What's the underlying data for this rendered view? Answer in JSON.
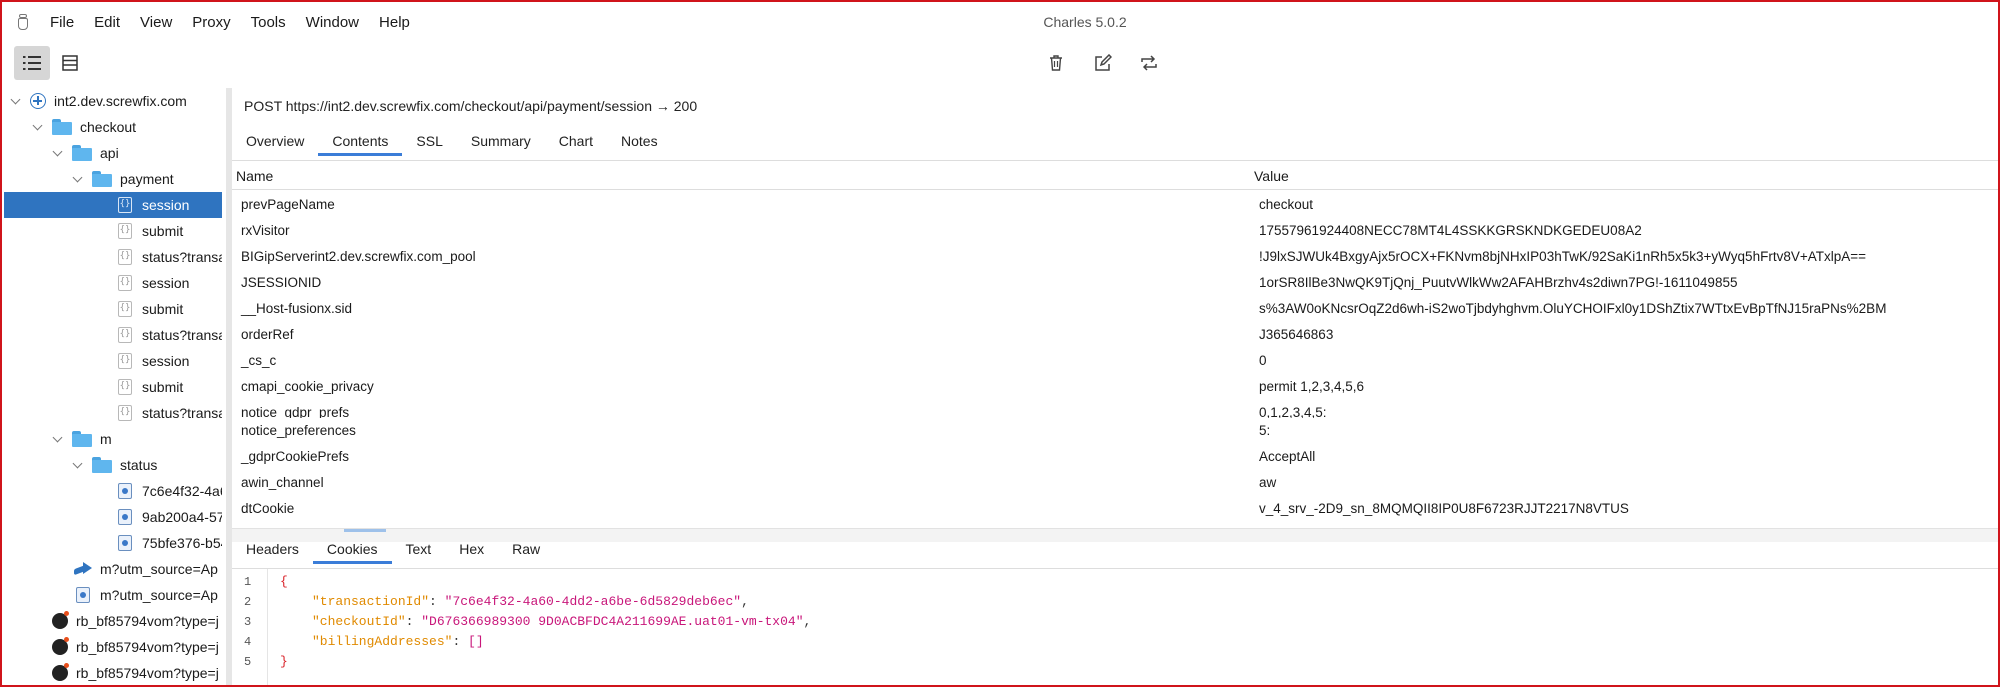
{
  "window": {
    "title": "Charles 5.0.2"
  },
  "menu": [
    "File",
    "Edit",
    "View",
    "Proxy",
    "Tools",
    "Window",
    "Help"
  ],
  "toolbar": {
    "icons": [
      "structure-view-icon",
      "sequence-view-icon",
      "trash-icon",
      "edit-icon",
      "repeat-icon"
    ]
  },
  "tree": [
    {
      "label": "int2.dev.screwfix.com",
      "icon": "host-icon",
      "depth": 0
    },
    {
      "label": "checkout",
      "icon": "folder-icon",
      "depth": 1
    },
    {
      "label": "api",
      "icon": "folder-icon",
      "depth": 2
    },
    {
      "label": "payment",
      "icon": "folder-icon",
      "depth": 3
    },
    {
      "label": "session",
      "icon": "document-icon",
      "depth": 4,
      "selected": true
    },
    {
      "label": "submit",
      "icon": "document-icon",
      "depth": 4
    },
    {
      "label": "status?transa",
      "icon": "document-icon",
      "depth": 4
    },
    {
      "label": "session",
      "icon": "document-icon",
      "depth": 4
    },
    {
      "label": "submit",
      "icon": "document-icon",
      "depth": 4
    },
    {
      "label": "status?transa",
      "icon": "document-icon",
      "depth": 4
    },
    {
      "label": "session",
      "icon": "document-icon",
      "depth": 4
    },
    {
      "label": "submit",
      "icon": "document-icon",
      "depth": 4
    },
    {
      "label": "status?transa",
      "icon": "document-icon",
      "depth": 4
    },
    {
      "label": "m",
      "icon": "folder-icon",
      "depth": 1
    },
    {
      "label": "status",
      "icon": "folder-icon",
      "depth": 2
    },
    {
      "label": "7c6e4f32-4a6",
      "icon": "gear-document-icon",
      "depth": 3
    },
    {
      "label": "9ab200a4-57",
      "icon": "gear-document-icon",
      "depth": 3
    },
    {
      "label": "75bfe376-b54",
      "icon": "gear-document-icon",
      "depth": 3
    },
    {
      "label": "m?utm_source=Ap",
      "icon": "redirect-icon",
      "depth": 2
    },
    {
      "label": "m?utm_source=Ap",
      "icon": "gear-document-icon",
      "depth": 2
    },
    {
      "label": "rb_bf85794vom?type=j",
      "icon": "bomb-icon",
      "depth": 1
    },
    {
      "label": "rb_bf85794vom?type=j",
      "icon": "bomb-icon",
      "depth": 1
    },
    {
      "label": "rb_bf85794vom?type=j",
      "icon": "bomb-icon",
      "depth": 1
    }
  ],
  "request": {
    "line": "POST https://int2.dev.screwfix.com/checkout/api/payment/session  → 200"
  },
  "top_tabs": [
    {
      "label": "Overview"
    },
    {
      "label": "Contents",
      "active": true
    },
    {
      "label": "SSL"
    },
    {
      "label": "Summary"
    },
    {
      "label": "Chart"
    },
    {
      "label": "Notes"
    }
  ],
  "table": {
    "headers": {
      "name": "Name",
      "value": "Value"
    },
    "rows": [
      {
        "name": "prevPageName",
        "value": "checkout"
      },
      {
        "name": "rxVisitor",
        "value": "17557961924408NECC78MT4L4SSKKGRSKNDKGEDEU08A2"
      },
      {
        "name": "BIGipServerint2.dev.screwfix.com_pool",
        "value": "!J9lxSJWUk4BxgyAjx5rOCX+FKNvm8bjNHxIP03hTwK/92SaKi1nRh5x5k3+yWyq5hFrtv8V+ATxlpA=="
      },
      {
        "name": "JSESSIONID",
        "value": "1orSR8IlBe3NwQK9TjQnj_PuutvWlkWw2AFAHBrzhv4s2diwn7PG!-1611049855"
      },
      {
        "name": "__Host-fusionx.sid",
        "value": "s%3AW0oKNcsrOqZ2d6wh-iS2woTjbdyhghvm.OluYCHOIFxl0y1DShZtix7WTtxEvBpTfNJ15raPNs%2BM"
      },
      {
        "name": "orderRef",
        "value": "J365646863"
      },
      {
        "name": "_cs_c",
        "value": "0"
      },
      {
        "name": "cmapi_cookie_privacy",
        "value": "permit 1,2,3,4,5,6"
      },
      {
        "name": "notice_gdpr_prefs",
        "value": "0,1,2,3,4,5:"
      },
      {
        "name": "notice_preferences",
        "value": "5:"
      },
      {
        "name": "_gdprCookiePrefs",
        "value": "AcceptAll"
      },
      {
        "name": "awin_channel",
        "value": "aw"
      },
      {
        "name": "dtCookie",
        "value": "v_4_srv_-2D9_sn_8MQMQII8IP0U8F6723RJJT2217N8VTUS"
      }
    ]
  },
  "bottom_tabs": [
    {
      "label": "Headers"
    },
    {
      "label": "Cookies",
      "active": true
    },
    {
      "label": "Text"
    },
    {
      "label": "Hex"
    },
    {
      "label": "Raw"
    }
  ],
  "code": {
    "line_numbers": [
      "1",
      "2",
      "3",
      "4",
      "5"
    ],
    "open_brace": "{",
    "close_brace": "}",
    "entries": [
      {
        "key": "\"transactionId\"",
        "sep": ": ",
        "value": "\"7c6e4f32-4a60-4dd2-a6be-6d5829deb6ec\"",
        "end": ","
      },
      {
        "key": "\"checkoutId\"",
        "sep": ": ",
        "value": "\"D676366989300 9D0ACBFDC4A211699AE.uat01-vm-tx04\"",
        "end": ","
      },
      {
        "key": "\"billingAddresses\"",
        "sep": ": ",
        "value": "[]",
        "end": ""
      }
    ]
  },
  "colors": {
    "selection": "#2f74c0",
    "active_tab_underline": "#3b7dd8",
    "frame_border": "#d0141b",
    "json_key": "#e08a00",
    "json_string": "#c8167a",
    "json_brace": "#d9232a"
  }
}
